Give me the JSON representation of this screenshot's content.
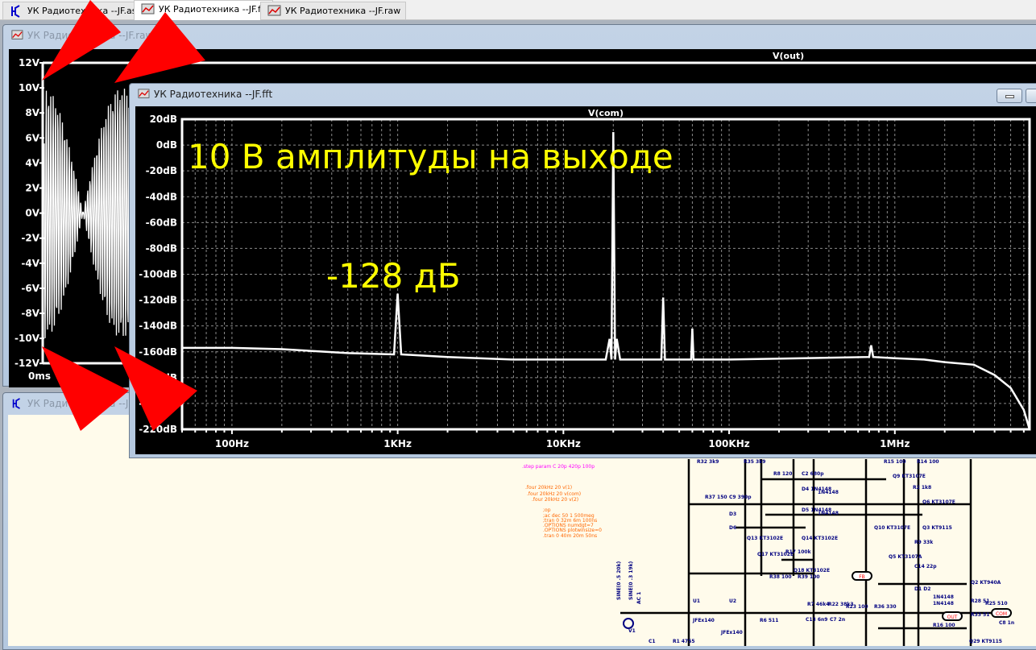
{
  "tabs": [
    {
      "label": "УК Радиотехника --JF.asc",
      "icon": "schematic-icon",
      "active": false
    },
    {
      "label": "УК Радиотехника --JF.fft",
      "icon": "waveform-icon",
      "active": true
    },
    {
      "label": "УК Радиотехника --JF.raw",
      "icon": "waveform-icon",
      "active": false
    }
  ],
  "raw_window": {
    "title": "УК Радиотехника --JF.raw",
    "trace": "V(out)",
    "x_tick": "0ms",
    "y_ticks": [
      "12V",
      "10V",
      "8V",
      "6V",
      "4V",
      "2V",
      "0V",
      "-2V",
      "-4V",
      "-6V",
      "-8V",
      "-10V",
      "-12V"
    ]
  },
  "asc_window": {
    "title": "УК Радиотехника --JF.asc",
    "directives_magenta": [
      ".step param C 20p 420p 100p"
    ],
    "directives": [
      ".four 20kHz 20 v(1)",
      ".four 20kHz 20 v(com)",
      ".four 20kHz 20 v(2)",
      ";op",
      ";ac dec 50 1 500meg",
      ";tran 0 32m 6m 100ns",
      ".OPTIONS numdgt=7",
      ".OPTIONS plotwinsize=0",
      ".tran 0 40m 20m 50ns"
    ],
    "components": [
      "R32 3k9",
      "R35 3k9",
      "R8 120",
      "C2 680p",
      "D4 1N4148",
      "R37 150",
      "C9 390p",
      "D3",
      "D6",
      "D5 1N4148",
      "1N4148",
      "1N4148",
      "Q13 KT3102E",
      "Q14 KT3102E",
      "Q17 KT3102E",
      "R17 100k",
      "Q18 KT3102E",
      "R38 100",
      "R39 100",
      "R15 100",
      "R14 100",
      "Q9 KT3107E",
      "R2 1k8",
      "Q6 KT3107E",
      "Q10 KT3107E",
      "Q3 KT9115",
      "R9 33k",
      "Q5 KT3107A",
      "C14 22p",
      "Q2 KT940A",
      "D1 D2",
      "1N4148",
      "1N4148",
      "R28 51",
      "R25 510",
      "R33 51",
      "C8 1n",
      "R16 100",
      "Q29 KT9115",
      "R7 46k4",
      "R22 38k3",
      "R23 100",
      "C13 6n9",
      "C7 2n",
      "R36 330",
      "R6 511",
      "U1",
      "U2",
      "JFEx140",
      "JFEx140",
      "R1 4755",
      "SINE(0 .5 20k)",
      "SINE(0 .3 19k)",
      "AC 1",
      "V1",
      "C1"
    ],
    "net_labels": [
      "OUT",
      "COM",
      "FB"
    ]
  },
  "fft_window": {
    "title": "УК Радиотехника --JF.fft"
  },
  "annotations": {
    "headline": "10 В амплитуды на выходе",
    "level": "-128 дБ"
  },
  "colors": {
    "trace": "#ffffff",
    "plot_bg": "#000000",
    "annotation": "#ffff00",
    "arrow": "#ff0000",
    "grid": "#8a8a8a",
    "schematic_wire": "#000080"
  },
  "chart_data": {
    "type": "line",
    "title": "V(com)",
    "xscale": "log",
    "xlim": [
      50,
      6500000
    ],
    "ylim": [
      -220,
      20
    ],
    "x_ticks": [
      "100Hz",
      "1KHz",
      "10KHz",
      "100KHz",
      "1MHz"
    ],
    "y_ticks": [
      "20dB",
      "0dB",
      "-20dB",
      "-40dB",
      "-60dB",
      "-80dB",
      "-100dB",
      "-120dB",
      "-140dB",
      "-160dB",
      "-180dB",
      "-200dB",
      "-220dB"
    ],
    "grid": true,
    "series": [
      {
        "points": [
          [
            50,
            -157
          ],
          [
            100,
            -157
          ],
          [
            200,
            -158
          ],
          [
            500,
            -161
          ],
          [
            950,
            -162
          ],
          [
            1000,
            -115
          ],
          [
            1050,
            -162
          ],
          [
            2000,
            -164
          ],
          [
            5000,
            -166
          ],
          [
            18000,
            -166
          ],
          [
            19000,
            -150
          ],
          [
            19500,
            -166
          ],
          [
            20000,
            10
          ],
          [
            20500,
            -166
          ],
          [
            21000,
            -150
          ],
          [
            22000,
            -166
          ],
          [
            39000,
            -166
          ],
          [
            40000,
            -118
          ],
          [
            41000,
            -166
          ],
          [
            59000,
            -166
          ],
          [
            60000,
            -142
          ],
          [
            61000,
            -166
          ],
          [
            100000,
            -166
          ],
          [
            700000,
            -164
          ],
          [
            720000,
            -155
          ],
          [
            740000,
            -164
          ],
          [
            1000000,
            -165
          ],
          [
            1500000,
            -166
          ],
          [
            2000000,
            -168
          ],
          [
            3000000,
            -170
          ],
          [
            4000000,
            -178
          ],
          [
            5000000,
            -188
          ],
          [
            6000000,
            -205
          ],
          [
            6500000,
            -220
          ]
        ]
      }
    ]
  }
}
